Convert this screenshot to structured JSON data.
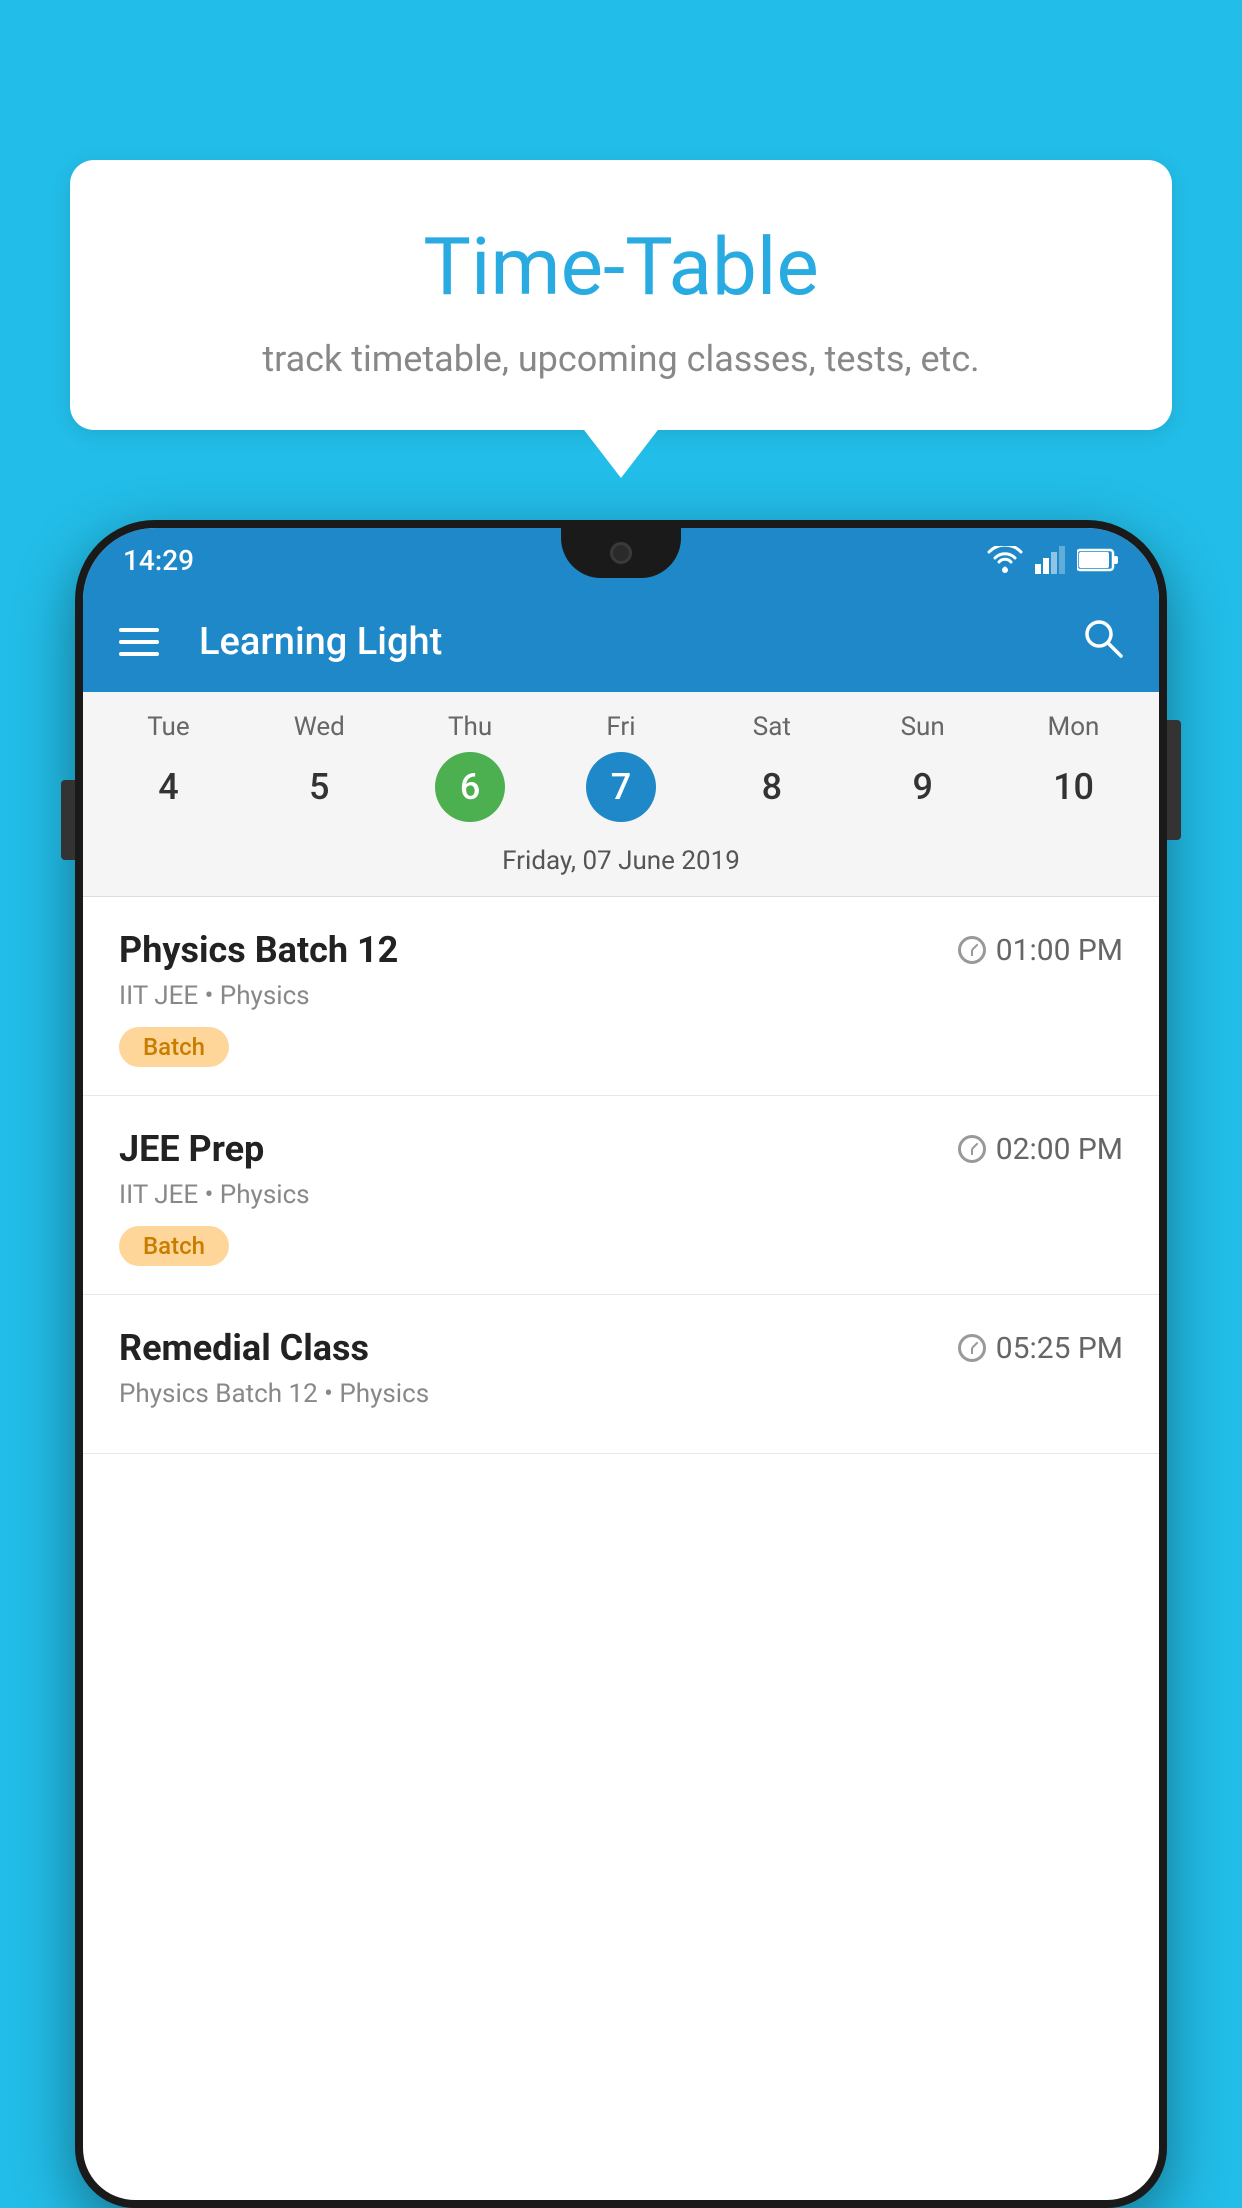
{
  "background_color": "#22bde8",
  "tooltip": {
    "title": "Time-Table",
    "subtitle": "track timetable, upcoming classes, tests, etc."
  },
  "phone": {
    "status_bar": {
      "time": "14:29"
    },
    "app_bar": {
      "title": "Learning Light"
    },
    "calendar": {
      "days": [
        {
          "name": "Tue",
          "num": "4",
          "state": "normal"
        },
        {
          "name": "Wed",
          "num": "5",
          "state": "normal"
        },
        {
          "name": "Thu",
          "num": "6",
          "state": "today"
        },
        {
          "name": "Fri",
          "num": "7",
          "state": "selected"
        },
        {
          "name": "Sat",
          "num": "8",
          "state": "normal"
        },
        {
          "name": "Sun",
          "num": "9",
          "state": "normal"
        },
        {
          "name": "Mon",
          "num": "10",
          "state": "normal"
        }
      ],
      "date_label": "Friday, 07 June 2019"
    },
    "schedule": [
      {
        "title": "Physics Batch 12",
        "time": "01:00 PM",
        "sub": "IIT JEE • Physics",
        "badge": "Batch"
      },
      {
        "title": "JEE Prep",
        "time": "02:00 PM",
        "sub": "IIT JEE • Physics",
        "badge": "Batch"
      },
      {
        "title": "Remedial Class",
        "time": "05:25 PM",
        "sub": "Physics Batch 12 • Physics",
        "badge": null
      }
    ]
  }
}
